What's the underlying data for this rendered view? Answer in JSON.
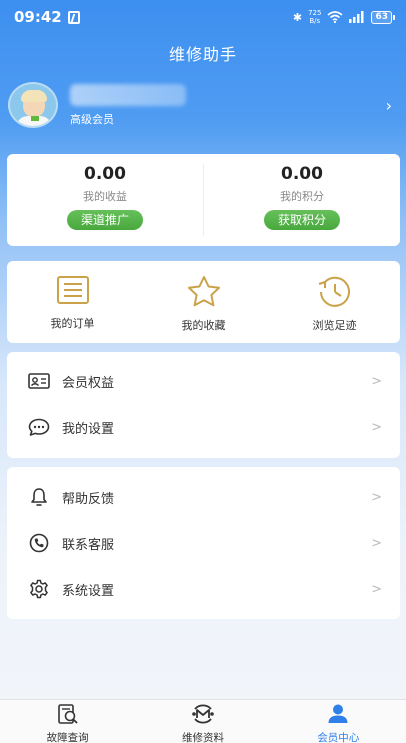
{
  "status_bar": {
    "time": "09:42",
    "speed_top": "725",
    "speed_bottom": "B/s",
    "battery": "63"
  },
  "header": {
    "title": "维修助手"
  },
  "profile": {
    "member_level": "高级会员",
    "arrow": "›"
  },
  "earnings": {
    "income": {
      "value": "0.00",
      "label": "我的收益",
      "button": "渠道推广"
    },
    "points": {
      "value": "0.00",
      "label": "我的积分",
      "button": "获取积分"
    }
  },
  "quick_actions": [
    {
      "label": "我的订单",
      "icon": "order-list-icon"
    },
    {
      "label": "我的收藏",
      "icon": "star-icon"
    },
    {
      "label": "浏览足迹",
      "icon": "history-clock-icon"
    }
  ],
  "menu_group_1": [
    {
      "label": "会员权益",
      "icon": "member-card-icon"
    },
    {
      "label": "我的设置",
      "icon": "chat-bubble-icon"
    }
  ],
  "menu_group_2": [
    {
      "label": "帮助反馈",
      "icon": "bell-icon"
    },
    {
      "label": "联系客服",
      "icon": "phone-icon"
    },
    {
      "label": "系统设置",
      "icon": "gear-icon"
    }
  ],
  "row_arrow": ">",
  "bottom_nav": [
    {
      "label": "故障查询",
      "icon": "fault-search-icon",
      "active": false
    },
    {
      "label": "维修资料",
      "icon": "repair-docs-icon",
      "active": false
    },
    {
      "label": "会员中心",
      "icon": "member-center-icon",
      "active": true
    }
  ],
  "colors": {
    "accent_blue": "#3d8ff0",
    "green_button": "#4fae44",
    "gold_icon": "#c9a24a",
    "active_nav": "#2f7fe8"
  }
}
